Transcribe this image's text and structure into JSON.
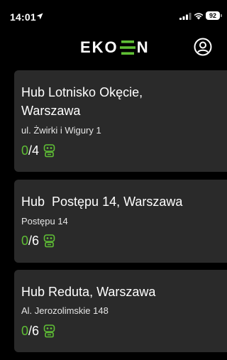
{
  "status_bar": {
    "time": "14:01",
    "battery": "92"
  },
  "header": {
    "logo_left": "EKO",
    "logo_right": "N"
  },
  "colors": {
    "accent": "#5fbf35",
    "card": "#2a2a2a",
    "background": "#000000"
  },
  "hubs": [
    {
      "title": "Hub Lotnisko Okęcie,\nWarszawa",
      "address": "ul. Żwirki i Wigury 1",
      "available": "0",
      "total": "4",
      "icon": "robot-icon"
    },
    {
      "title": "Hub  Postępu 14, Warszawa",
      "address": "Postępu 14",
      "available": "0",
      "total": "6",
      "icon": "robot-icon"
    },
    {
      "title": "Hub Reduta, Warszawa",
      "address": "Al. Jerozolimskie 148",
      "available": "0",
      "total": "6",
      "icon": "robot-icon"
    }
  ]
}
